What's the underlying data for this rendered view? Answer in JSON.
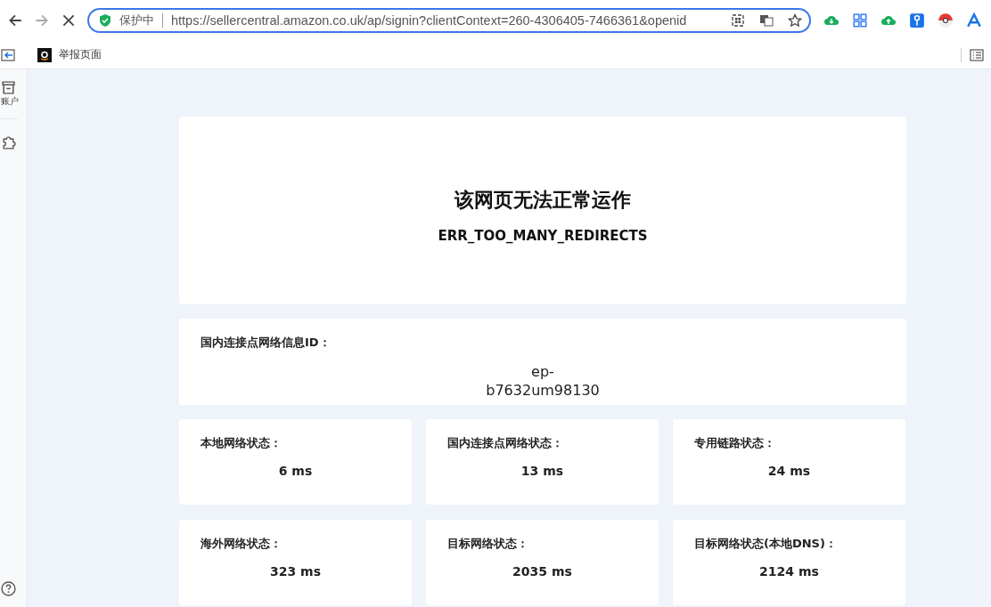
{
  "toolbar": {
    "security_label": "保护中",
    "url": "https://sellercentral.amazon.co.uk/ap/signin?clientContext=260-4306405-7466361&openid"
  },
  "bookmarks": [
    {
      "label": "举报页面"
    }
  ],
  "sidebar": {
    "items": [
      {
        "label": "账户"
      }
    ]
  },
  "error": {
    "title": "该网页无法正常运作",
    "code": "ERR_TOO_MANY_REDIRECTS"
  },
  "node_info": {
    "label": "国内连接点网络信息ID：",
    "value": "ep-b7632um98130"
  },
  "metrics": [
    {
      "label": "本地网络状态：",
      "value": "6 ms"
    },
    {
      "label": "国内连接点网络状态：",
      "value": "13 ms"
    },
    {
      "label": "专用链路状态：",
      "value": "24 ms"
    },
    {
      "label": "海外网络状态：",
      "value": "323 ms"
    },
    {
      "label": "目标网络状态：",
      "value": "2035 ms"
    },
    {
      "label": "目标网络状态(本地DNS)：",
      "value": "2124 ms"
    }
  ]
}
